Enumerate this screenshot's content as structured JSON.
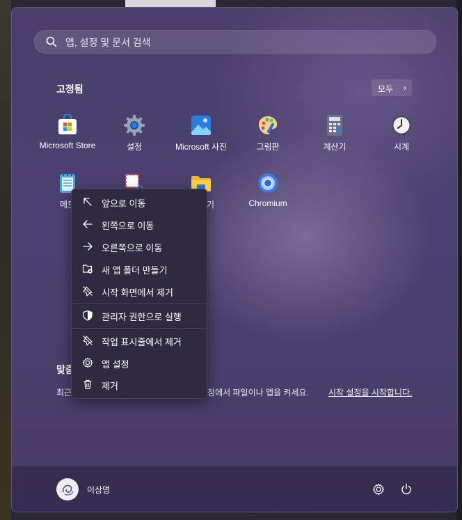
{
  "search": {
    "placeholder": "앱, 설정 및 문서 검색"
  },
  "pinned": {
    "title": "고정됨",
    "all_button": "모두",
    "apps": [
      {
        "label": "Microsoft Store",
        "icon": "microsoft-store-icon"
      },
      {
        "label": "설정",
        "icon": "settings-gear-icon"
      },
      {
        "label": "Microsoft 사진",
        "icon": "photos-icon"
      },
      {
        "label": "그림판",
        "icon": "paint-palette-icon"
      },
      {
        "label": "계산기",
        "icon": "calculator-icon"
      },
      {
        "label": "시계",
        "icon": "clock-icon"
      },
      {
        "label": "메모",
        "icon": "notepad-icon"
      },
      {
        "label": "",
        "icon": "snipping-tool-icon"
      },
      {
        "label": "색기",
        "icon": "file-explorer-icon"
      },
      {
        "label": "Chromium",
        "icon": "chromium-icon"
      }
    ]
  },
  "context_menu": {
    "items": [
      {
        "label": "앞으로 이동",
        "icon": "arrow-up-left-icon"
      },
      {
        "label": "왼쪽으로 이동",
        "icon": "arrow-left-icon"
      },
      {
        "label": "오른쪽으로 이동",
        "icon": "arrow-right-icon"
      },
      {
        "label": "새 앱 폴더 만들기",
        "icon": "new-folder-icon"
      },
      {
        "label": "시작 화면에서 제거",
        "icon": "unpin-icon"
      },
      {
        "label": "관리자 권한으로 실행",
        "icon": "shield-icon"
      },
      {
        "label": "작업 표시줄에서 제거",
        "icon": "unpin-taskbar-icon"
      },
      {
        "label": "앱 설정",
        "icon": "gear-icon"
      },
      {
        "label": "제거",
        "icon": "trash-icon"
      }
    ]
  },
  "recommended": {
    "title": "맞춤",
    "text_prefix": "최근",
    "text_middle": "설정에서 파일이나 앱을 켜세요.",
    "link": "시작 설정을 시작합니다."
  },
  "footer": {
    "user_name": "이상명"
  },
  "colors": {
    "panel": "#4a3f6c",
    "menu": "#2f2a40"
  }
}
